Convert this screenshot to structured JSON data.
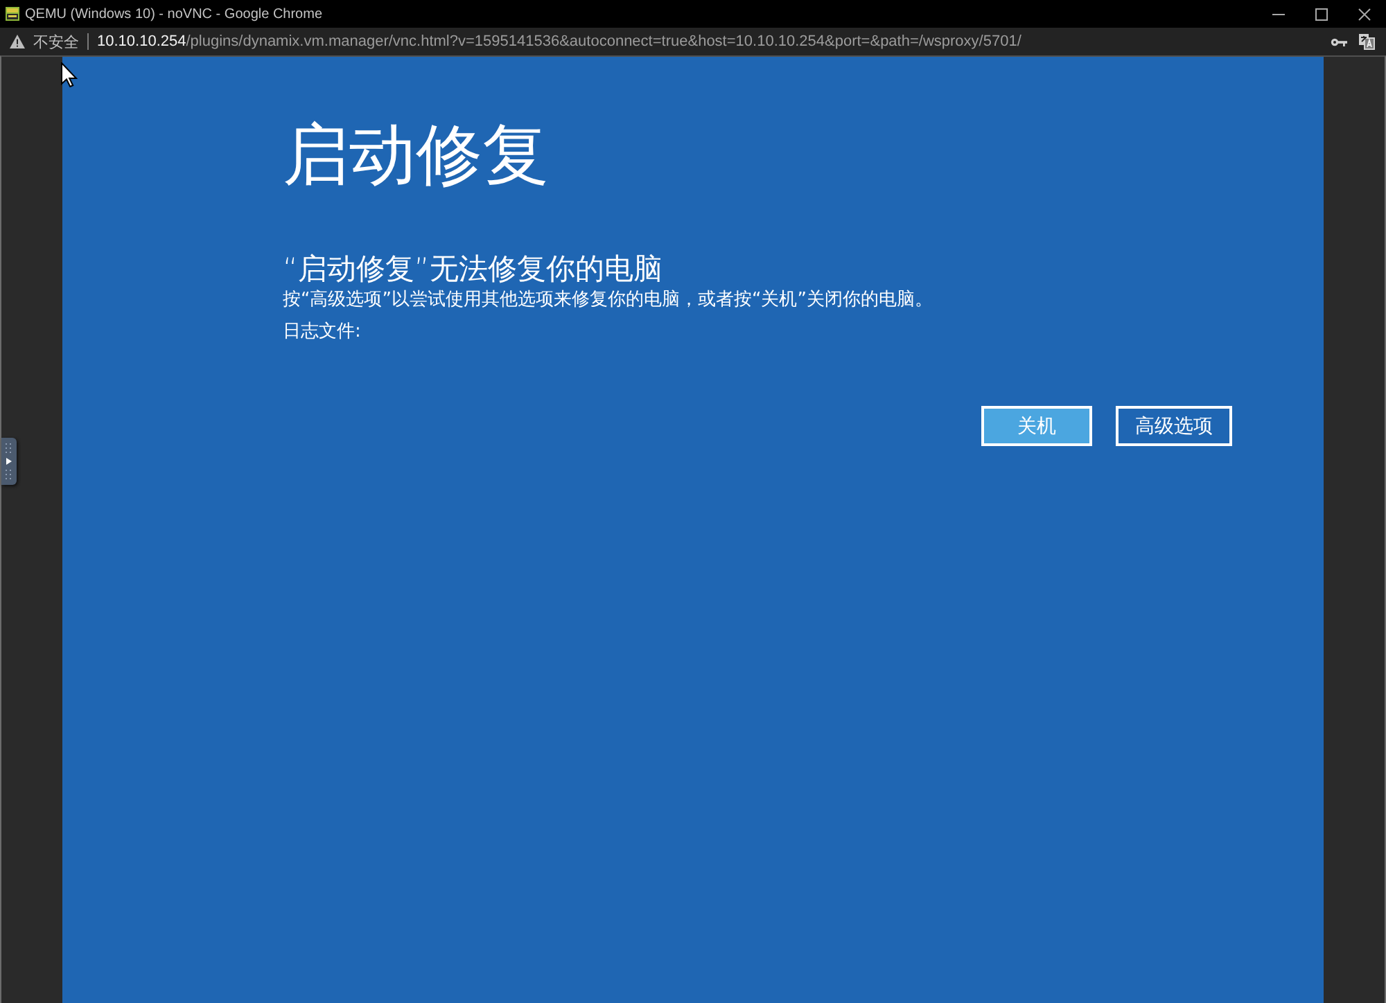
{
  "window": {
    "title": "QEMU (Windows 10) - noVNC - Google Chrome"
  },
  "address_bar": {
    "security_label": "不安全",
    "url_host": "10.10.10.254",
    "url_path": "/plugins/dynamix.vm.manager/vnc.html?v=1595141536&autoconnect=true&host=10.10.10.254&port=&path=/wsproxy/5701/"
  },
  "vnc_screen": {
    "title": "启动修复",
    "heading": "“启动修复”无法修复你的电脑",
    "message": "按“高级选项”以尝试使用其他选项来修复你的电脑，或者按“关机”关闭你的电脑。",
    "log_label": "日志文件:",
    "buttons": [
      {
        "label": "关机",
        "selected": true
      },
      {
        "label": "高级选项",
        "selected": false
      }
    ]
  }
}
